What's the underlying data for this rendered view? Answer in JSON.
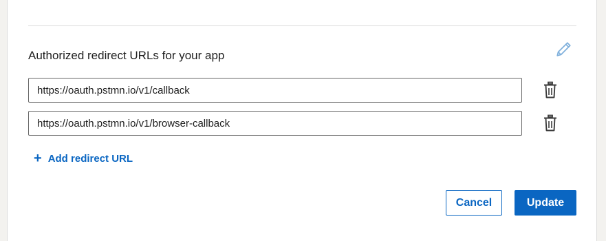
{
  "section": {
    "title": "Authorized redirect URLs for your app",
    "edit_icon": "pencil-icon"
  },
  "redirect_urls": [
    {
      "value": "https://oauth.pstmn.io/v1/callback",
      "delete_icon": "trash-icon"
    },
    {
      "value": "https://oauth.pstmn.io/v1/browser-callback",
      "delete_icon": "trash-icon"
    }
  ],
  "add_link": {
    "icon": "+",
    "label": "Add redirect URL"
  },
  "actions": {
    "cancel_label": "Cancel",
    "update_label": "Update"
  },
  "colors": {
    "accent": "#0a66c2",
    "edit_icon": "#7fb0dc",
    "border": "#666666",
    "divider": "#dcdcdc"
  }
}
